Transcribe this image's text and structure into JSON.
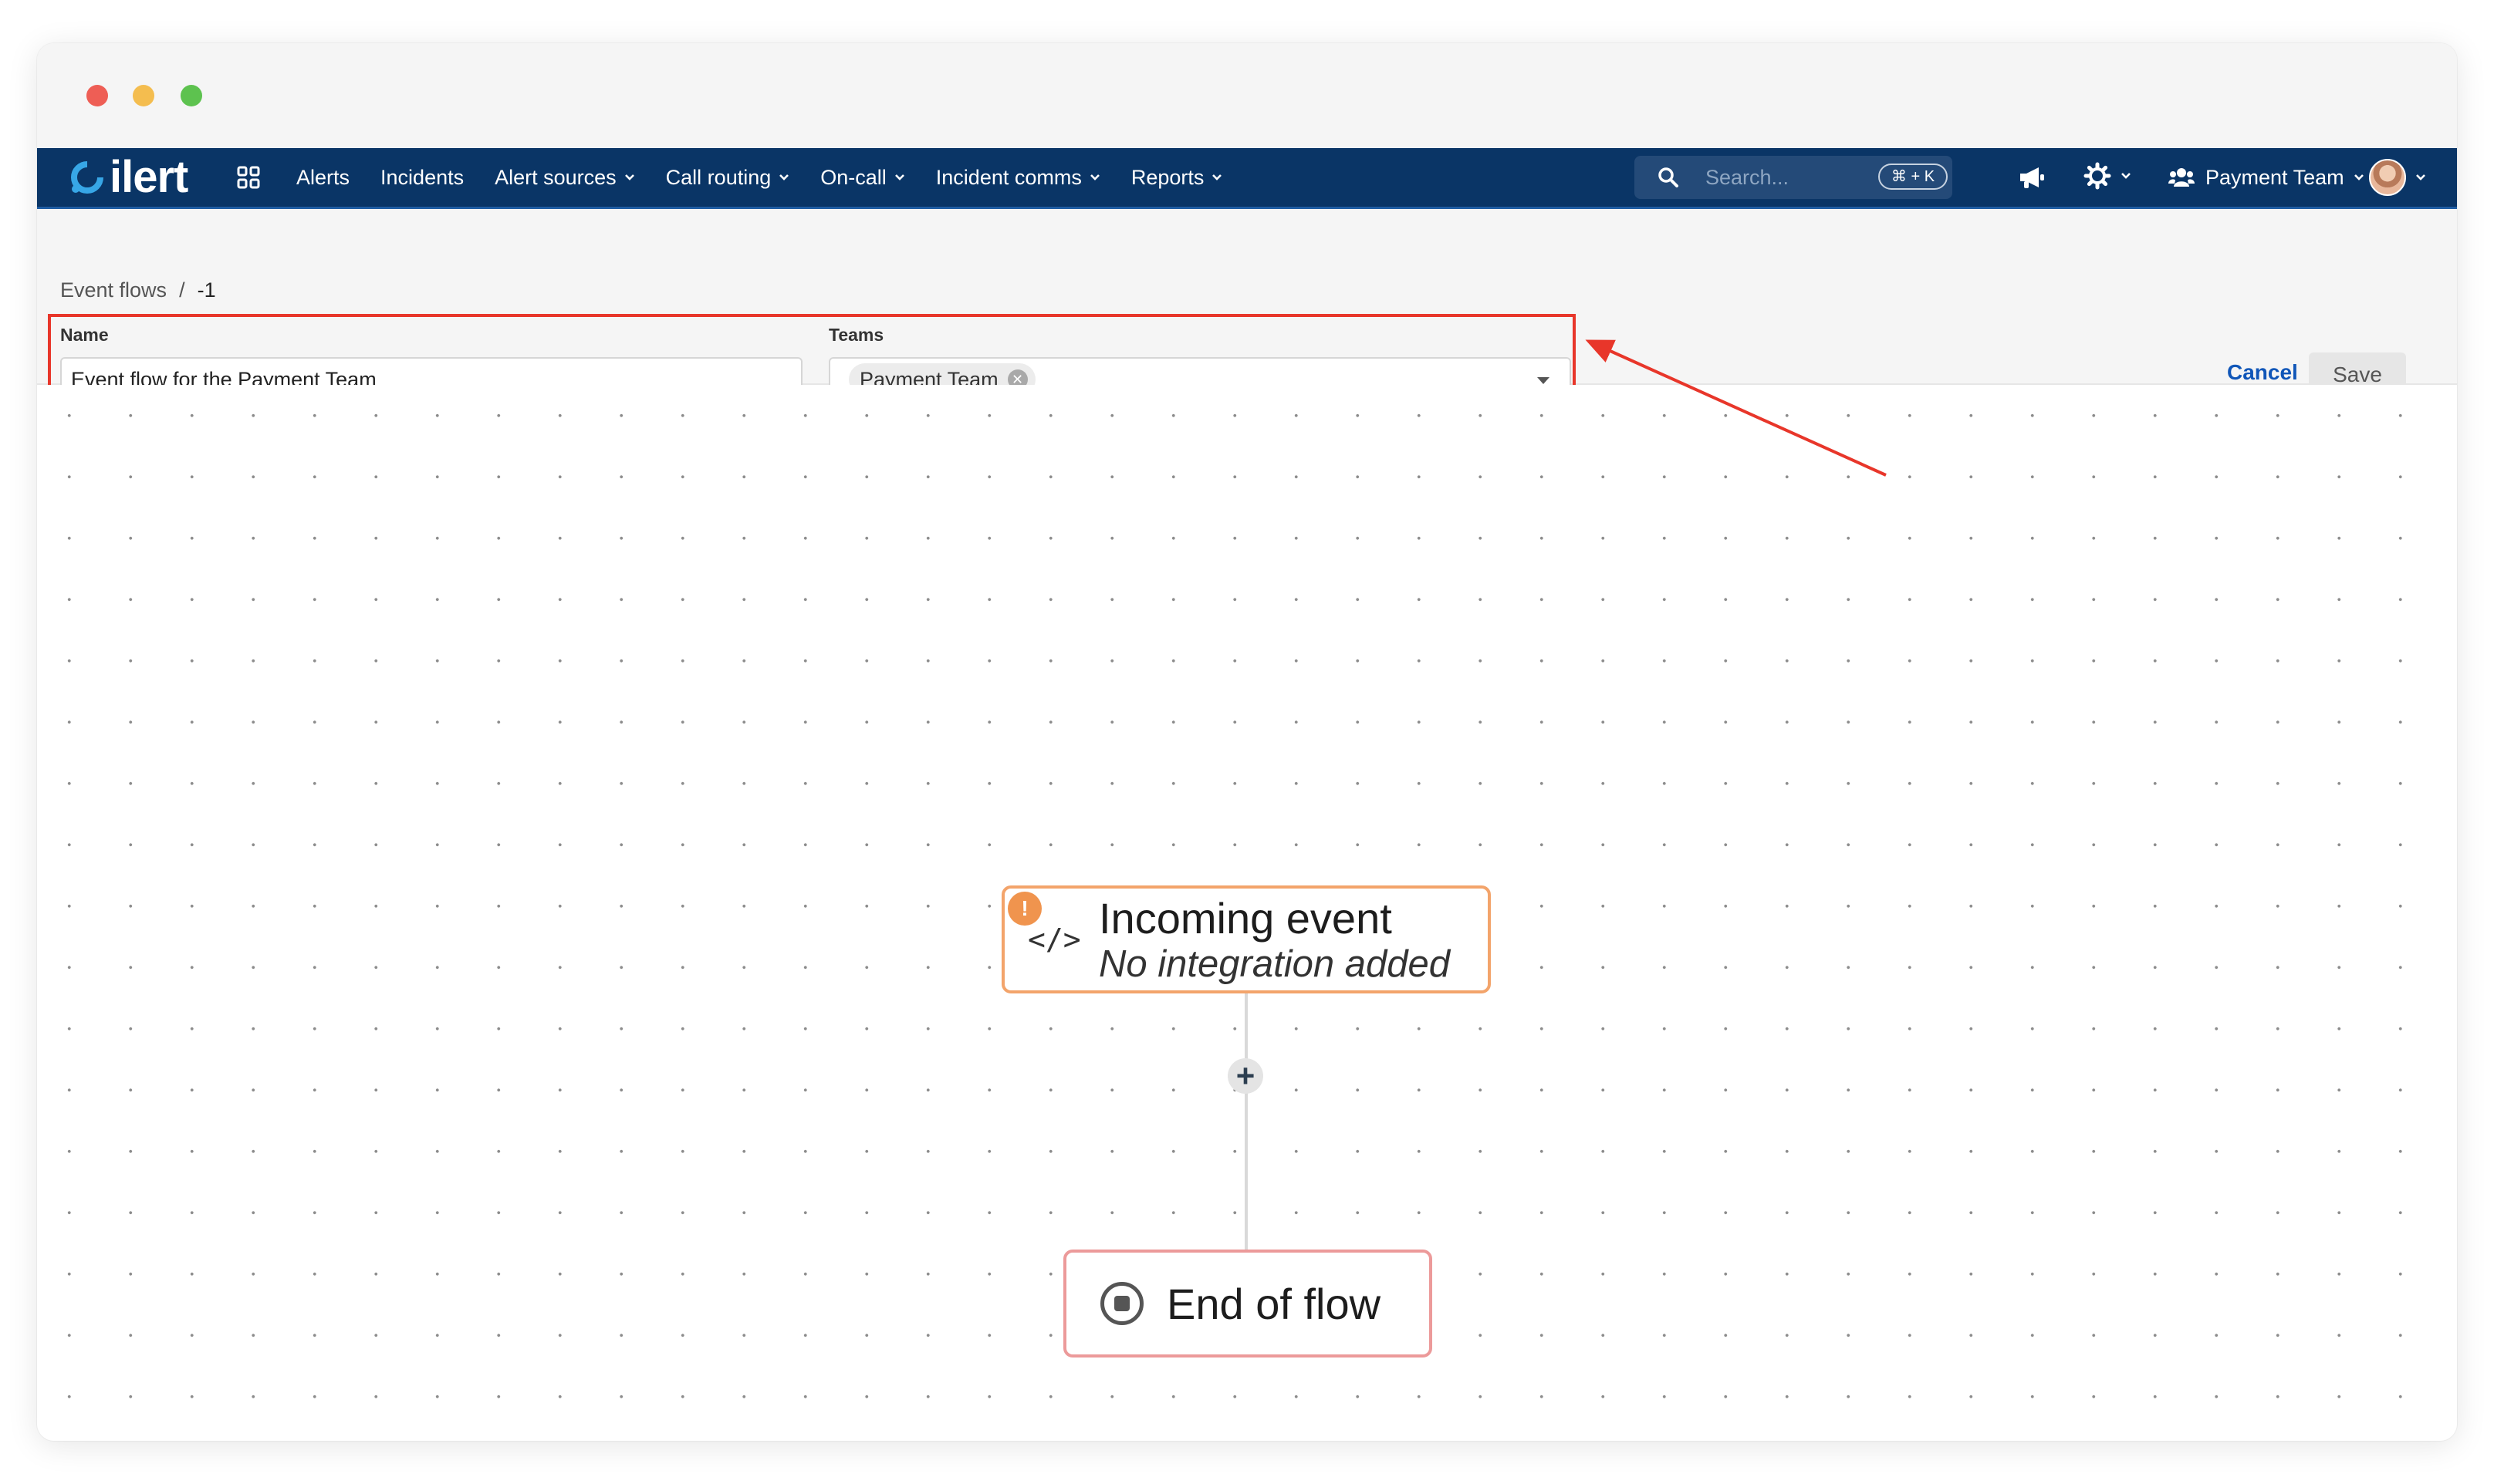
{
  "brand": {
    "logo_text": "ilert"
  },
  "nav": {
    "items": [
      {
        "label": "Alerts",
        "dropdown": false
      },
      {
        "label": "Incidents",
        "dropdown": false
      },
      {
        "label": "Alert sources",
        "dropdown": true
      },
      {
        "label": "Call routing",
        "dropdown": true
      },
      {
        "label": "On-call",
        "dropdown": true
      },
      {
        "label": "Incident comms",
        "dropdown": true
      },
      {
        "label": "Reports",
        "dropdown": true
      }
    ],
    "search_placeholder": "Search...",
    "search_shortcut": "⌘ + K",
    "team_menu_label": "Payment Team"
  },
  "breadcrumb": {
    "parent": "Event flows",
    "separator": "/",
    "current": "-1"
  },
  "form": {
    "name_label": "Name",
    "name_value": "Event flow for the Payment Team",
    "teams_label": "Teams",
    "teams_selected": [
      "Payment Team"
    ],
    "cancel_label": "Cancel",
    "save_label": "Save"
  },
  "flow": {
    "incoming": {
      "title": "Incoming event",
      "subtitle": "No integration added",
      "warning_mark": "!"
    },
    "add_step_symbol": "+",
    "end": {
      "title": "End of flow"
    }
  },
  "colors": {
    "navbar": "#0a3566",
    "annotation": "#e8362a",
    "incoming_border": "#f3a46b",
    "end_border": "#ec9a9a",
    "link": "#1056b8"
  }
}
